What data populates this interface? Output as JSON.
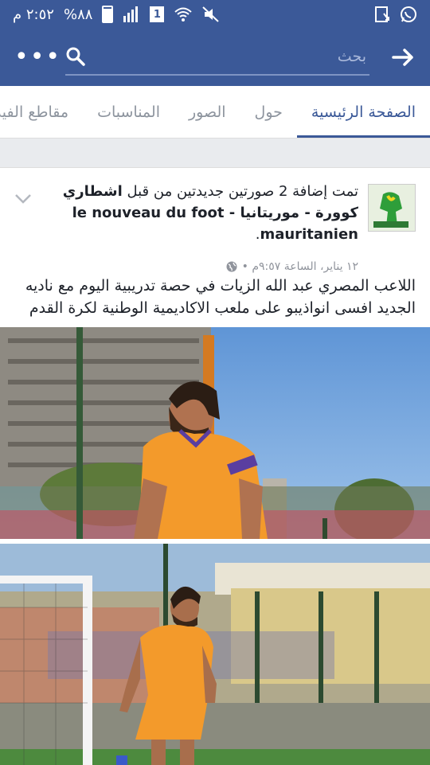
{
  "status_bar": {
    "time": "٢:٥٢ م",
    "battery_percent": "%٨٨",
    "battery_level": 0.88,
    "sim_label": "1"
  },
  "nav": {
    "more_label": "•••",
    "search_placeholder": "بحث"
  },
  "tabs": [
    {
      "label": "الصفحة الرئيسية",
      "active": true
    },
    {
      "label": "حول",
      "active": false
    },
    {
      "label": "الصور",
      "active": false
    },
    {
      "label": "المناسبات",
      "active": false
    },
    {
      "label": "مقاطع الفيديو",
      "active": false
    }
  ],
  "post": {
    "header_prefix": "تمت إضافة 2 صورتين جديدتين من قبل ",
    "page_name": "اشطاري كوورة - موريتانيا - le nouveau du foot mauritanien",
    "header_suffix": ".",
    "timestamp": "١٢ يناير، الساعة ٩:٥٧م •",
    "body": "اللاعب المصري عبد الله الزيات في حصة تدريبية اليوم مع ناديه الجديد افسى انواذيبو على ملعب الاكاديمية الوطنية لكرة القدم"
  },
  "colors": {
    "brand": "#3b5998",
    "jersey": "#f39a2b"
  },
  "icons": [
    "more-icon",
    "search-icon",
    "back-arrow-icon",
    "globe-icon",
    "chevron-down-icon",
    "whatsapp-icon",
    "download-icon",
    "mute-icon",
    "wifi-icon",
    "signal-icon"
  ]
}
